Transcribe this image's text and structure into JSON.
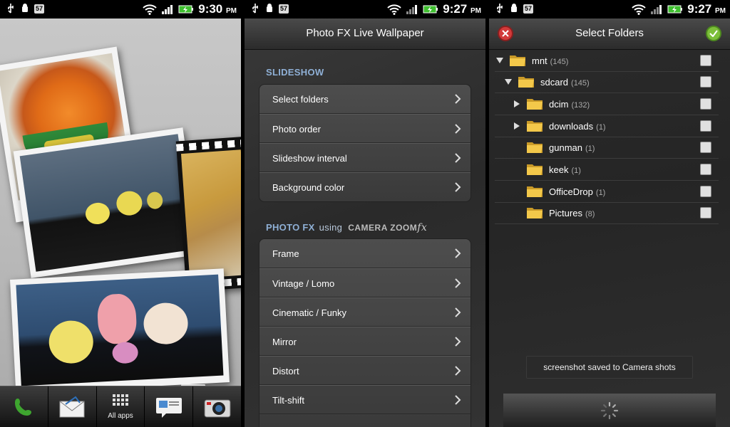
{
  "status_bars": [
    {
      "badge": "57",
      "time": "9:30",
      "ampm": "PM"
    },
    {
      "badge": "57",
      "time": "9:27",
      "ampm": "PM"
    },
    {
      "badge": "57",
      "time": "9:27",
      "ampm": "PM"
    }
  ],
  "home": {
    "dock": [
      {
        "icon": "phone-icon",
        "label": ""
      },
      {
        "icon": "mail-icon",
        "label": ""
      },
      {
        "icon": "apps-grid-icon",
        "label": "All apps"
      },
      {
        "icon": "messages-icon",
        "label": ""
      },
      {
        "icon": "camera-icon",
        "label": ""
      }
    ]
  },
  "settings": {
    "title": "Photo FX Live Wallpaper",
    "slideshow_header": "SLIDESHOW",
    "slideshow_items": [
      "Select folders",
      "Photo order",
      "Slideshow interval",
      "Background color"
    ],
    "photofx_header": "PHOTO FX",
    "photofx_using": "using",
    "camera_zoom": "CAMERA ZOOM",
    "camera_zoom_fx": "fx",
    "photofx_items": [
      "Frame",
      "Vintage / Lomo",
      "Cinematic / Funky",
      "Mirror",
      "Distort",
      "Tilt-shift"
    ]
  },
  "folders": {
    "title": "Select Folders",
    "items": [
      {
        "name": "mnt",
        "count": "(145)",
        "level": 0,
        "arrow": "expanded"
      },
      {
        "name": "sdcard",
        "count": "(145)",
        "level": 1,
        "arrow": "expanded"
      },
      {
        "name": "dcim",
        "count": "(132)",
        "level": 2,
        "arrow": "collapsed"
      },
      {
        "name": "downloads",
        "count": "(1)",
        "level": 2,
        "arrow": "collapsed"
      },
      {
        "name": "gunman",
        "count": "(1)",
        "level": 2,
        "arrow": "none"
      },
      {
        "name": "keek",
        "count": "(1)",
        "level": 2,
        "arrow": "none"
      },
      {
        "name": "OfficeDrop",
        "count": "(1)",
        "level": 2,
        "arrow": "none"
      },
      {
        "name": "Pictures",
        "count": "(8)",
        "level": 2,
        "arrow": "none"
      }
    ],
    "toast": "screenshot saved to Camera shots"
  },
  "colors": {
    "section_blue": "#8fb0d6",
    "cancel_red": "#d23a3a",
    "confirm_green": "#7cbf3a",
    "folder_yellow": "#f3c84a"
  }
}
